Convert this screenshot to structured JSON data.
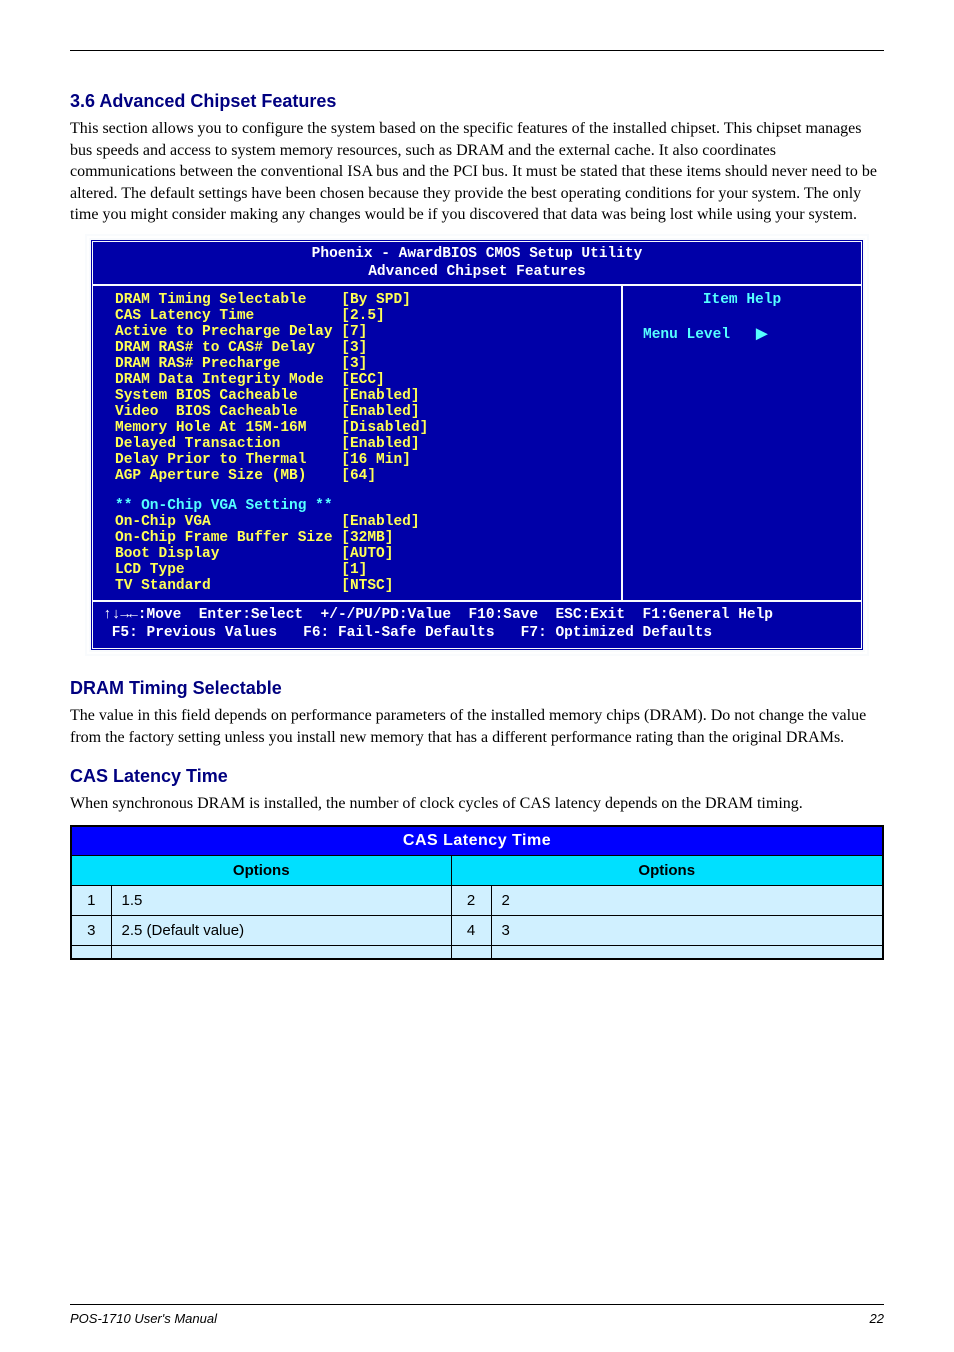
{
  "page": {
    "section_intro": "This section allows you to configure the system based on the specific features of the installed chipset. This chipset manages bus speeds and access to system memory resources, such as DRAM and the external cache. It also coordinates communications between the conventional ISA bus and the PCI bus. It must be stated that these items should never need to be altered. The default settings have been chosen because they provide the best operating conditions for your system. The only time you might consider making any changes would be if you discovered that data was being lost while using your system.",
    "heading1": "3.6 Advanced Chipset Features",
    "heading2": "DRAM Timing Selectable",
    "heading2_text": "The value in this field depends on performance parameters of the installed memory chips (DRAM). Do not change the value from the factory setting unless you install new memory that has a different performance rating than the original DRAMs.",
    "heading3": "CAS Latency Time",
    "heading3_text": "When synchronous DRAM is installed, the number of clock cycles of CAS latency depends on the DRAM timing."
  },
  "bios": {
    "title": "Phoenix - AwardBIOS CMOS Setup Utility",
    "subtitle": "Advanced Chipset Features",
    "help_title": "Item Help",
    "menu_level_label": "Menu Level",
    "menu_level_arrow": "▶",
    "rows": [
      {
        "label": "DRAM Timing Selectable   ",
        "value": "[By SPD]"
      },
      {
        "label": "CAS Latency Time         ",
        "value": "[2.5]"
      },
      {
        "label": "Active to Precharge Delay",
        "value": "[7]"
      },
      {
        "label": "DRAM RAS# to CAS# Delay  ",
        "value": "[3]"
      },
      {
        "label": "DRAM RAS# Precharge      ",
        "value": "[3]"
      },
      {
        "label": "DRAM Data Integrity Mode ",
        "value": "[ECC]"
      },
      {
        "label": "System BIOS Cacheable    ",
        "value": "[Enabled]"
      },
      {
        "label": "Video  BIOS Cacheable    ",
        "value": "[Enabled]"
      },
      {
        "label": "Memory Hole At 15M-16M   ",
        "value": "[Disabled]"
      },
      {
        "label": "Delayed Transaction      ",
        "value": "[Enabled]"
      },
      {
        "label": "Delay Prior to Thermal   ",
        "value": "[16 Min]"
      },
      {
        "label": "AGP Aperture Size (MB)   ",
        "value": "[64]"
      }
    ],
    "section_header": "** On-Chip VGA Setting **",
    "rows2": [
      {
        "label": "On-Chip VGA              ",
        "value": "[Enabled]"
      },
      {
        "label": "On-Chip Frame Buffer Size",
        "value": "[32MB]"
      },
      {
        "label": "Boot Display             ",
        "value": "[AUTO]"
      },
      {
        "label": "LCD Type                 ",
        "value": "[1]"
      },
      {
        "label": "TV Standard              ",
        "value": "[NTSC]"
      }
    ],
    "footer1": "↑↓→←:Move  Enter:Select  +/-/PU/PD:Value  F10:Save  ESC:Exit  F1:General Help",
    "footer2": " F5: Previous Values   F6: Fail-Safe Defaults   F7: Optimized Defaults"
  },
  "table": {
    "title": "CAS Latency Time",
    "headers": [
      "Options",
      "Options"
    ],
    "rows": [
      {
        "n1": "1",
        "o1": "1.5",
        "n2": "2",
        "o2": "2"
      },
      {
        "n1": "3",
        "o1": "2.5 (Default value)",
        "n2": "4",
        "o2": "3"
      },
      {
        "n1": "",
        "o1": "",
        "n2": "",
        "o2": ""
      }
    ]
  },
  "footer": {
    "left": "POS-1710 User's Manual",
    "right": "22"
  }
}
